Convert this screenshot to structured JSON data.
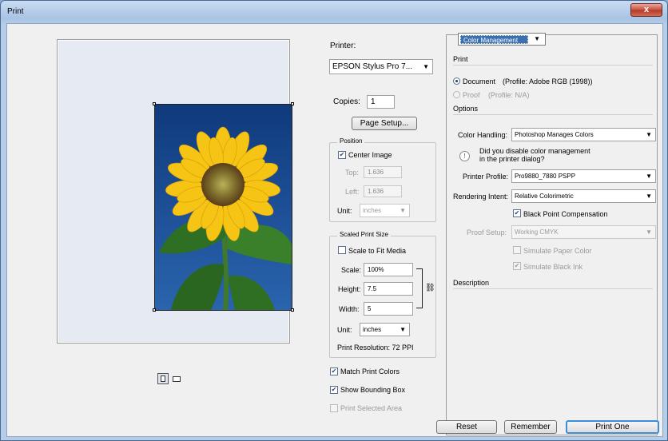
{
  "window": {
    "title": "Print",
    "close_glyph": "x"
  },
  "printer": {
    "label": "Printer:",
    "selected": "EPSON Stylus Pro 7..."
  },
  "copies": {
    "label": "Copies:",
    "value": "1"
  },
  "page_setup_label": "Page Setup...",
  "position": {
    "legend": "Position",
    "center_image": {
      "label": "Center Image",
      "checked": true
    },
    "top": {
      "label": "Top:",
      "value": "1.636"
    },
    "left": {
      "label": "Left:",
      "value": "1.636"
    },
    "unit": {
      "label": "Unit:",
      "value": "inches"
    }
  },
  "scaled": {
    "legend": "Scaled Print Size",
    "scale_to_fit": {
      "label": "Scale to Fit Media",
      "checked": false
    },
    "scale": {
      "label": "Scale:",
      "value": "100%"
    },
    "height": {
      "label": "Height:",
      "value": "7.5"
    },
    "width": {
      "label": "Width:",
      "value": "5"
    },
    "unit": {
      "label": "Unit:",
      "value": "inches"
    },
    "resolution": "Print Resolution: 72 PPI"
  },
  "checkboxes": {
    "match_colors": {
      "label": "Match Print Colors",
      "checked": true
    },
    "bounding_box": {
      "label": "Show Bounding Box",
      "checked": true
    },
    "selected_area": {
      "label": "Print Selected Area",
      "checked": false,
      "disabled": true
    }
  },
  "color_mgmt": {
    "menu": "Color Management",
    "print_heading": "Print",
    "document": {
      "label": "Document",
      "profile": "(Profile: Adobe RGB (1998))",
      "selected": true
    },
    "proof": {
      "label": "Proof",
      "profile": "(Profile: N/A)"
    },
    "options_heading": "Options",
    "color_handling": {
      "label": "Color Handling:",
      "value": "Photoshop Manages Colors"
    },
    "warning_line1": "Did you disable color management",
    "warning_line2": "in the printer dialog?",
    "warning_glyph": "!",
    "printer_profile": {
      "label": "Printer Profile:",
      "value": "Pro9880_7880 PSPP"
    },
    "rendering_intent": {
      "label": "Rendering Intent:",
      "value": "Relative Colorimetric"
    },
    "black_point": {
      "label": "Black Point Compensation",
      "checked": true
    },
    "proof_setup": {
      "label": "Proof Setup:",
      "value": "Working CMYK"
    },
    "simulate_paper": {
      "label": "Simulate Paper Color",
      "checked": false
    },
    "simulate_ink": {
      "label": "Simulate Black Ink",
      "checked": true
    },
    "description_heading": "Description"
  },
  "buttons": {
    "reset": "Reset",
    "remember": "Remember",
    "print_one": "Print One"
  },
  "glyphs": {
    "check": "✔",
    "arrow": "▼",
    "link": "⛓"
  },
  "colors": {
    "accent": "#3a6fb0",
    "sky": "#1d4f96",
    "petal": "#f5c414"
  }
}
